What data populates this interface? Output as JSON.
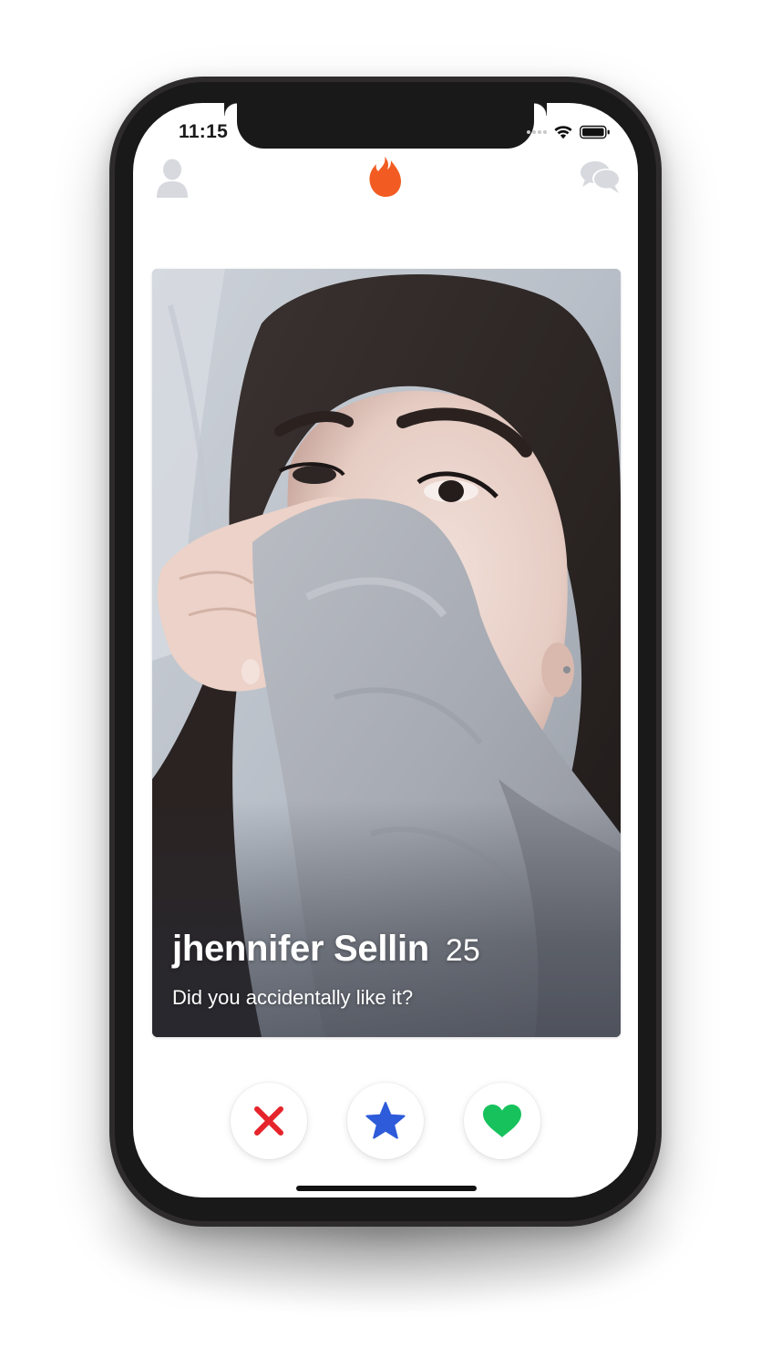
{
  "status_bar": {
    "time": "11:15"
  },
  "nav": {
    "left_icon": "profile-icon",
    "center_icon": "flame-logo-icon",
    "right_icon": "messages-icon"
  },
  "colors": {
    "brand_flame": "#f25c22",
    "nope_red": "#e5242b",
    "superlike_blue": "#2e5bd9",
    "like_green": "#17c25c",
    "inactive_icon": "#d7d9de"
  },
  "card": {
    "name": "jhennifer Sellin",
    "age": "25",
    "bio": "Did you accidentally like it?"
  },
  "actions": [
    {
      "icon": "close-icon"
    },
    {
      "icon": "star-icon"
    },
    {
      "icon": "heart-icon"
    }
  ]
}
